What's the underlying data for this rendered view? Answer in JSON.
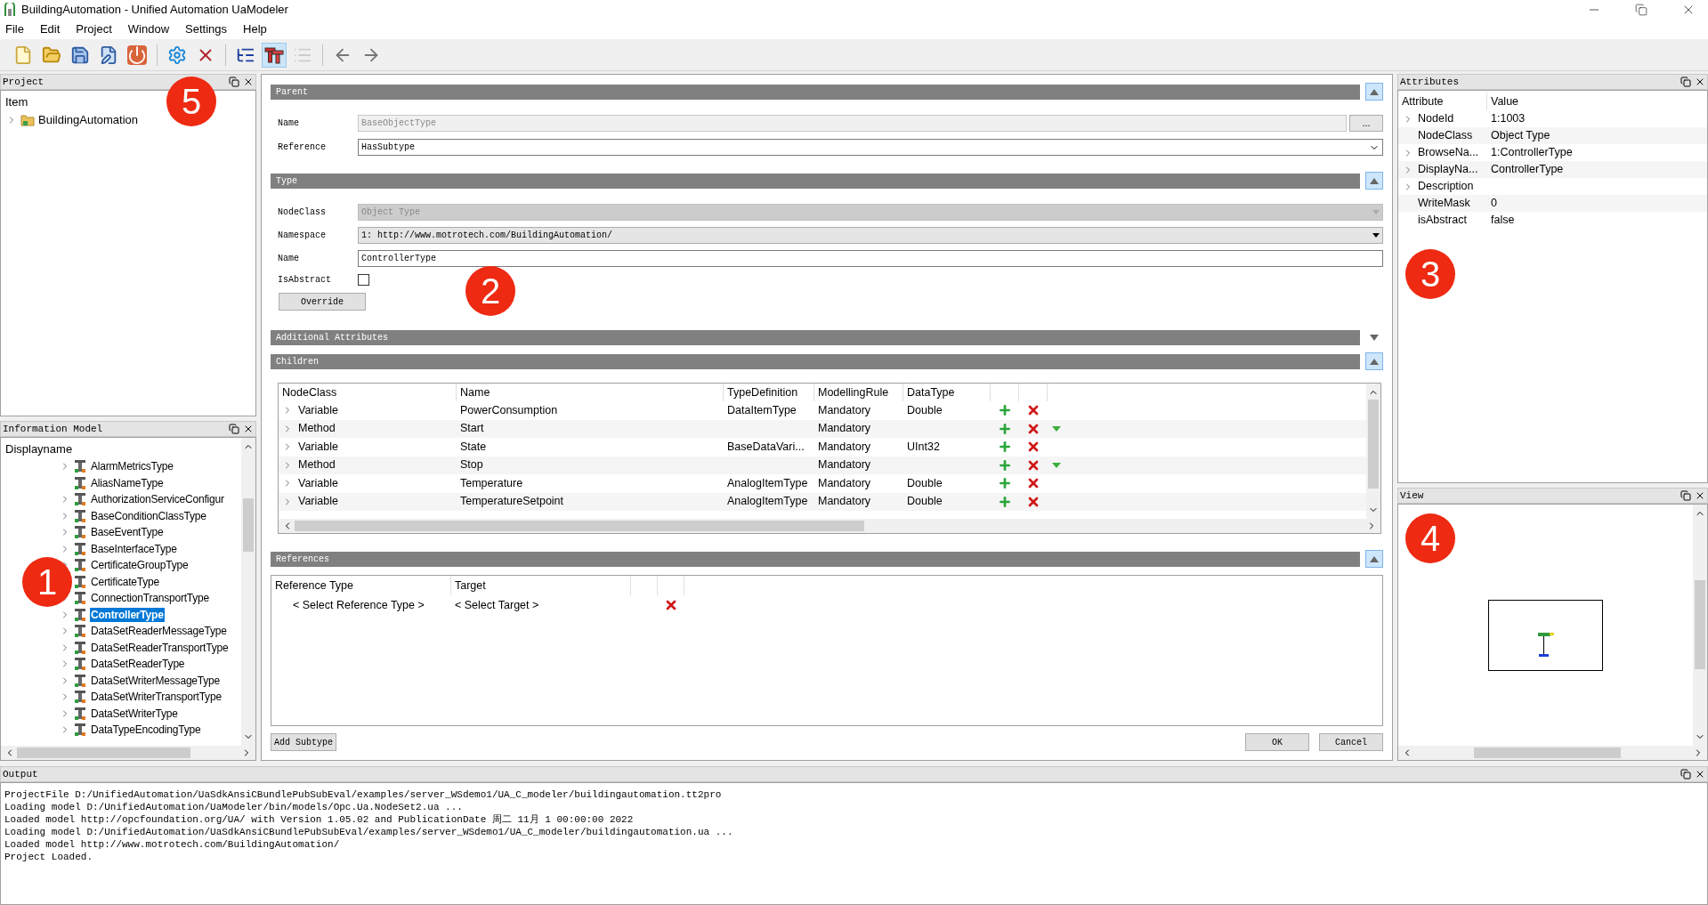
{
  "window": {
    "title": "BuildingAutomation - Unified Automation UaModeler"
  },
  "menu": [
    "File",
    "Edit",
    "Project",
    "Window",
    "Settings",
    "Help"
  ],
  "toolbar": [
    {
      "selected": false,
      "disabled": false
    },
    {
      "selected": false,
      "disabled": false
    },
    {
      "selected": false,
      "disabled": false
    },
    {
      "selected": false,
      "disabled": false
    },
    {
      "selected": false,
      "disabled": false
    },
    {
      "selected": false,
      "disabled": false
    },
    {
      "selected": false,
      "disabled": false
    },
    {
      "selected": false,
      "disabled": false
    },
    {
      "selected": true,
      "disabled": false
    },
    {
      "selected": false,
      "disabled": true
    },
    {
      "selected": false,
      "disabled": false
    },
    {
      "selected": false,
      "disabled": false
    }
  ],
  "project": {
    "title": "Project",
    "badge": "5",
    "header": "Item",
    "items": [
      {
        "label": "BuildingAutomation",
        "expanded": false
      }
    ]
  },
  "information_model": {
    "title": "Information Model",
    "badge": "1",
    "header": "Displayname",
    "items": [
      {
        "label": "AlarmMetricsType",
        "expandable": true,
        "selected": false
      },
      {
        "label": "AliasNameType",
        "expandable": false,
        "selected": false
      },
      {
        "label": "AuthorizationServiceConfigur",
        "expandable": true,
        "selected": false
      },
      {
        "label": "BaseConditionClassType",
        "expandable": true,
        "selected": false
      },
      {
        "label": "BaseEventType",
        "expandable": true,
        "selected": false
      },
      {
        "label": "BaseInterfaceType",
        "expandable": true,
        "selected": false
      },
      {
        "label": "CertificateGroupType",
        "expandable": true,
        "selected": false
      },
      {
        "label": "CertificateType",
        "selected": false
      },
      {
        "label": "ConnectionTransportType",
        "expandable": true,
        "selected": false
      },
      {
        "label": "ControllerType",
        "expandable": true,
        "selected": true
      },
      {
        "label": "DataSetReaderMessageType",
        "expandable": true,
        "selected": false
      },
      {
        "label": "DataSetReaderTransportType",
        "expandable": true,
        "selected": false
      },
      {
        "label": "DataSetReaderType",
        "expandable": true,
        "selected": false
      },
      {
        "label": "DataSetWriterMessageType",
        "expandable": true,
        "selected": false
      },
      {
        "label": "DataSetWriterTransportType",
        "expandable": true,
        "selected": false
      },
      {
        "label": "DataSetWriterType",
        "expandable": true,
        "selected": false
      },
      {
        "label": "DataTypeEncodingType",
        "expandable": true,
        "selected": false
      }
    ]
  },
  "editor": {
    "badge": "2",
    "parent": {
      "title": "Parent",
      "expanded": true,
      "name_label": "Name",
      "name_value": "BaseObjectType",
      "name_disabled": true,
      "browse_button": "...",
      "reference_label": "Reference",
      "reference_value": "HasSubtype"
    },
    "type": {
      "title": "Type",
      "expanded": true,
      "nodeclass_label": "NodeClass",
      "nodeclass_value": "Object Type",
      "nodeclass_disabled": true,
      "namespace_label": "Namespace",
      "namespace_value": "1: http://www.motrotech.com/BuildingAutomation/",
      "name_label": "Name",
      "name_value": "ControllerType",
      "isabstract_label": "IsAbstract",
      "isabstract_checked": false,
      "override_button": "Override"
    },
    "additional_attributes": {
      "title": "Additional Attributes",
      "expanded": false
    },
    "children": {
      "title": "Children",
      "expanded": true,
      "columns": [
        "NodeClass",
        "Name",
        "TypeDefinition",
        "ModellingRule",
        "DataType"
      ],
      "rows": [
        {
          "kind": "variable",
          "nodeclass": "Variable",
          "name": "PowerConsumption",
          "type_definition": "DataItemType",
          "modelling_rule": "Mandatory",
          "data_type": "Double"
        },
        {
          "kind": "method",
          "nodeclass": "Method",
          "name": "Start",
          "modelling_rule": "Mandatory"
        },
        {
          "kind": "variable",
          "nodeclass": "Variable",
          "name": "State",
          "type_definition": "BaseDataVari...",
          "modelling_rule": "Mandatory",
          "data_type": "UInt32"
        },
        {
          "kind": "method",
          "nodeclass": "Method",
          "name": "Stop",
          "modelling_rule": "Mandatory"
        },
        {
          "kind": "variable",
          "nodeclass": "Variable",
          "name": "Temperature",
          "type_definition": "AnalogItemType",
          "modelling_rule": "Mandatory",
          "data_type": "Double"
        },
        {
          "kind": "variable",
          "nodeclass": "Variable",
          "name": "TemperatureSetpoint",
          "type_definition": "AnalogItemType",
          "modelling_rule": "Mandatory",
          "data_type": "Double"
        }
      ]
    },
    "references": {
      "title": "References",
      "expanded": true,
      "columns": [
        "Reference Type",
        "Target"
      ],
      "rows": [
        {
          "reference_type": "< Select Reference Type >",
          "target": "< Select Target >"
        }
      ]
    },
    "add_subtype_button": "Add Subtype",
    "ok_button": "OK",
    "cancel_button": "Cancel"
  },
  "attributes": {
    "title": "Attributes",
    "badge": "3",
    "columns": [
      "Attribute",
      "Value"
    ],
    "rows": [
      {
        "name": "NodeId",
        "value": "1:1003",
        "expandable": true
      },
      {
        "name": "NodeClass",
        "value": "Object Type",
        "expandable": false
      },
      {
        "name": "BrowseNa...",
        "value": "1:ControllerType",
        "expandable": true
      },
      {
        "name": "DisplayNa...",
        "value": "ControllerType",
        "expandable": true
      },
      {
        "name": "Description",
        "expandable": true
      },
      {
        "name": "WriteMask",
        "value": "0",
        "expandable": false
      },
      {
        "name": "isAbstract",
        "value": "false",
        "expandable": false
      }
    ]
  },
  "view": {
    "title": "View",
    "badge": "4"
  },
  "output": {
    "title": "Output",
    "lines": [
      "ProjectFile D:/UnifiedAutomation/UaSdkAnsiCBundlePubSubEval/examples/server_WSdemo1/UA_C_modeler/buildingautomation.tt2pro",
      "Loading model D:/UnifiedAutomation/UaModeler/bin/models/Opc.Ua.NodeSet2.ua ...",
      "Loaded model http://opcfoundation.org/UA/ with Version 1.05.02 and PublicationDate 周二 11月 1 00:00:00 2022",
      "Loading model D:/UnifiedAutomation/UaSdkAnsiCBundlePubSubEval/examples/server_WSdemo1/UA_C_modeler/buildingautomation.ua ...",
      "Loaded model http://www.motrotech.com/BuildingAutomation/",
      "Project Loaded."
    ]
  }
}
